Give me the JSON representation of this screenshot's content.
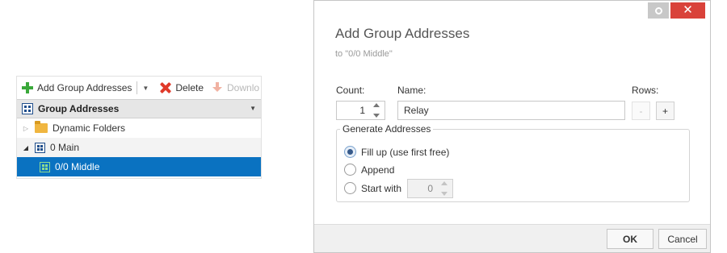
{
  "toolbar": {
    "add_label": "Add Group Addresses",
    "delete_label": "Delete",
    "download_label": "Downlo"
  },
  "tree": {
    "header_title": "Group Addresses",
    "items": [
      {
        "label": "Dynamic Folders"
      },
      {
        "label": "0 Main"
      },
      {
        "label": "0/0 Middle"
      }
    ]
  },
  "dialog": {
    "title": "Add Group Addresses",
    "subtitle": "to \"0/0 Middle\"",
    "count_label": "Count:",
    "count_value": "1",
    "name_label": "Name:",
    "name_value": "Relay",
    "rows_label": "Rows:",
    "rows_minus": "-",
    "rows_plus": "+",
    "generate_label": "Generate Addresses",
    "options": [
      {
        "label": "Fill up (use first free)",
        "checked": true
      },
      {
        "label": "Append",
        "checked": false
      },
      {
        "label": "Start with",
        "checked": false
      }
    ],
    "start_value": "0",
    "ok_label": "OK",
    "cancel_label": "Cancel",
    "close_glyph": "✕"
  },
  "colors": {
    "selection": "#0a72c1",
    "close_button": "#d9423a",
    "add_icon": "#3aa83a",
    "delete_icon": "#e03a2a",
    "folder_icon": "#f0b640"
  }
}
